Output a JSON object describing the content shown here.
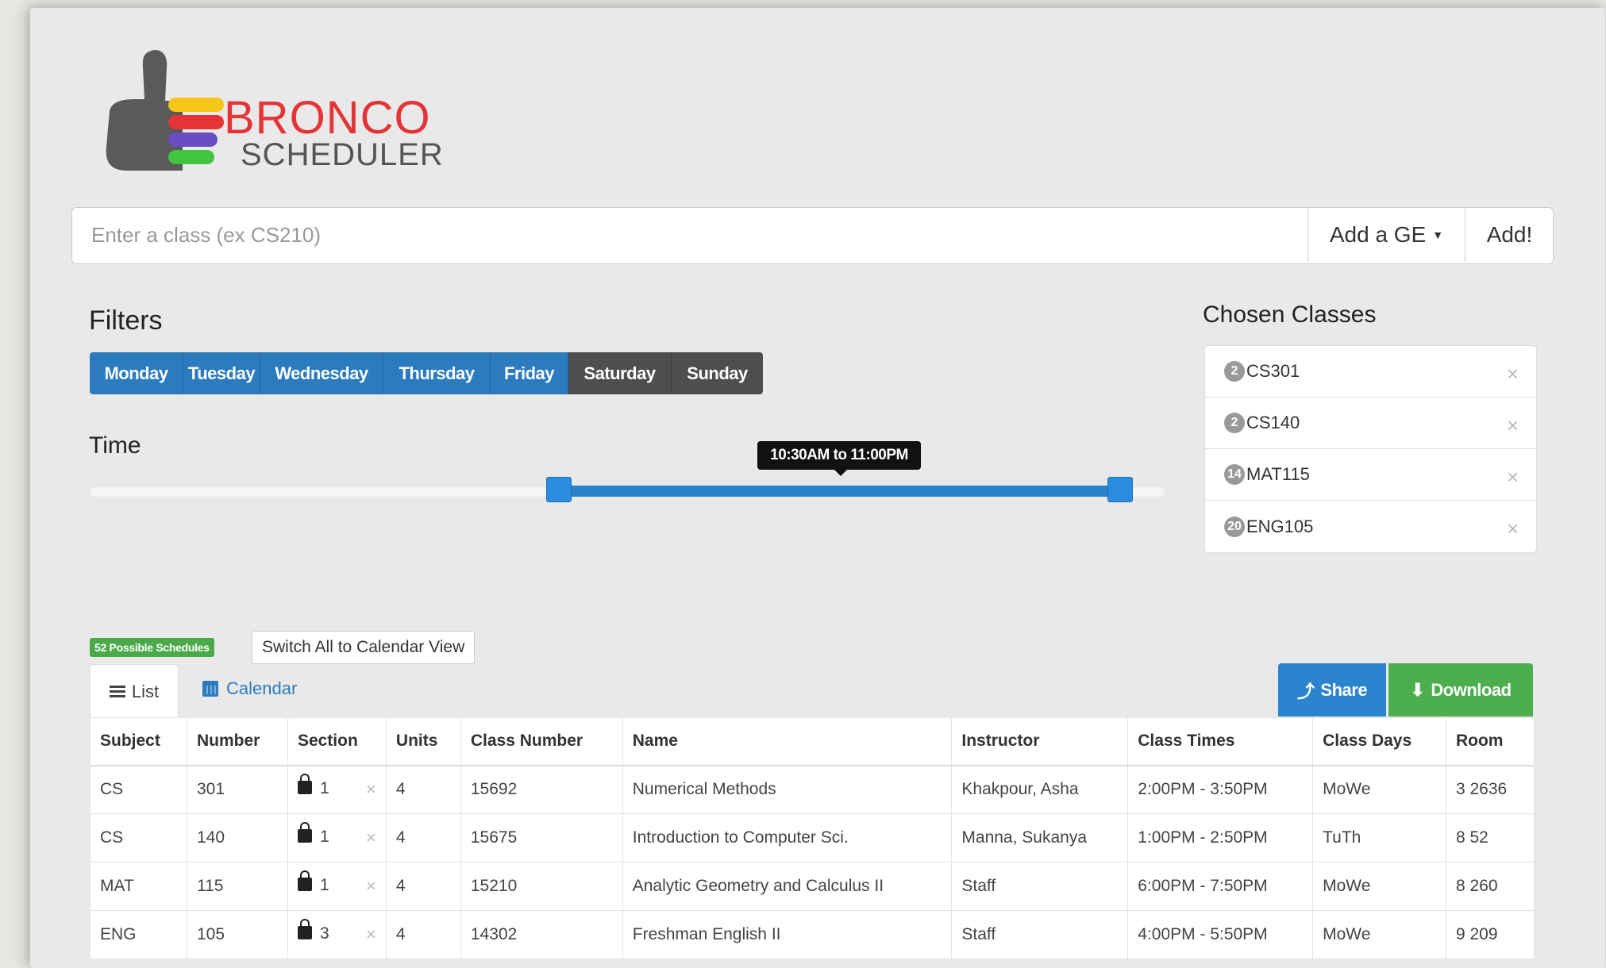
{
  "logo": {
    "line1": "BRONCO",
    "line2": "SCHEDULER",
    "colors": [
      "#f5c518",
      "#e53437",
      "#6a4cc4",
      "#41c541"
    ]
  },
  "search": {
    "placeholder": "Enter a class (ex CS210)",
    "value": "",
    "ge_label": "Add a GE",
    "add_label": "Add!"
  },
  "filters": {
    "title": "Filters",
    "days": [
      {
        "label": "Monday",
        "active": true
      },
      {
        "label": "Tuesday",
        "active": true
      },
      {
        "label": "Wednesday",
        "active": true
      },
      {
        "label": "Thursday",
        "active": true
      },
      {
        "label": "Friday",
        "active": true
      },
      {
        "label": "Saturday",
        "active": false
      },
      {
        "label": "Sunday",
        "active": false
      }
    ],
    "time_title": "Time",
    "time_range_label": "10:30AM to 11:00PM"
  },
  "chosen": {
    "title": "Chosen Classes",
    "items": [
      {
        "count": "2",
        "code": "CS301"
      },
      {
        "count": "2",
        "code": "CS140"
      },
      {
        "count": "14",
        "code": "MAT115"
      },
      {
        "count": "20",
        "code": "ENG105"
      }
    ],
    "close_glyph": "×"
  },
  "results": {
    "possible_label": "52 Possible Schedules",
    "switch_label": "Switch All to Calendar View",
    "tab_list": "List",
    "tab_calendar": "Calendar",
    "share_label": "Share",
    "download_label": "Download"
  },
  "table": {
    "headers": [
      "Subject",
      "Number",
      "Section",
      "Units",
      "Class Number",
      "Name",
      "Instructor",
      "Class Times",
      "Class Days",
      "Room"
    ],
    "rows": [
      [
        "CS",
        "301",
        "1",
        "4",
        "15692",
        "Numerical Methods",
        "Khakpour, Asha",
        "2:00PM - 3:50PM",
        "MoWe",
        "3 2636"
      ],
      [
        "CS",
        "140",
        "1",
        "4",
        "15675",
        "Introduction to Computer Sci.",
        "Manna, Sukanya",
        "1:00PM - 2:50PM",
        "TuTh",
        "8 52"
      ],
      [
        "MAT",
        "115",
        "1",
        "4",
        "15210",
        "Analytic Geometry and Calculus II",
        "Staff",
        "6:00PM - 7:50PM",
        "MoWe",
        "8 260"
      ],
      [
        "ENG",
        "105",
        "3",
        "4",
        "14302",
        "Freshman English II",
        "Staff",
        "4:00PM - 5:50PM",
        "MoWe",
        "9 209"
      ]
    ]
  },
  "colors": {
    "primary": "#2b7bbe",
    "success": "#4cae4c",
    "inactive_day": "#4e4e4e",
    "brand_red": "#e53437"
  }
}
